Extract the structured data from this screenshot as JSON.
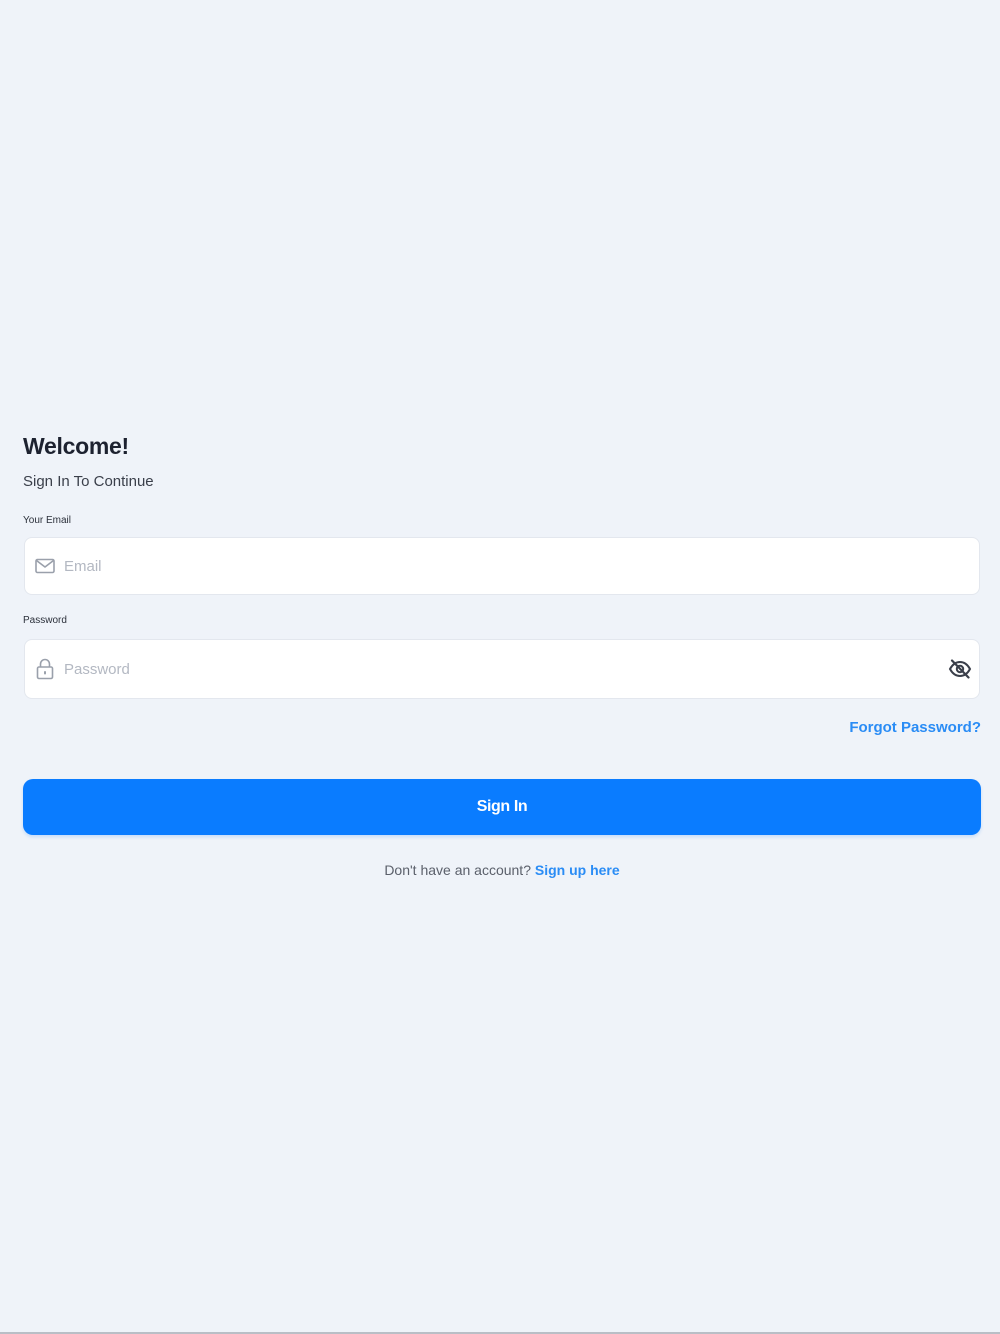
{
  "header": {
    "title": "Welcome!",
    "subtitle": "Sign In To Continue"
  },
  "email": {
    "label": "Your Email",
    "placeholder": "Email",
    "value": "",
    "icon": "mail-icon"
  },
  "password": {
    "label": "Password",
    "placeholder": "Password",
    "value": "",
    "icon": "lock-icon",
    "toggle_icon": "eye-off-icon"
  },
  "forgot_password": "Forgot Password?",
  "sign_in_button": "Sign In",
  "signup": {
    "prompt": "Don't have an account?",
    "link": "Sign up here"
  },
  "colors": {
    "background": "#eff3f9",
    "primary": "#0a7cff",
    "link": "#2a8cf5",
    "input_background": "#ffffff",
    "placeholder": "#b3b8c2"
  }
}
